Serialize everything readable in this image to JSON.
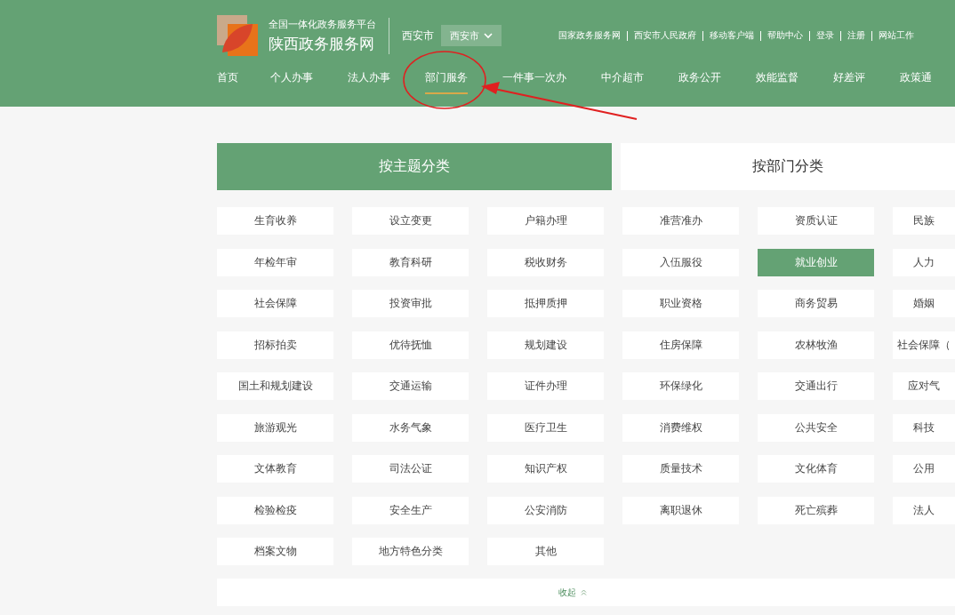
{
  "header": {
    "platform": "全国一体化政务服务平台",
    "site_name": "陕西政务服务网",
    "city": "西安市",
    "city_select": "西安市",
    "top_links": [
      "国家政务服务网",
      "西安市人民政府",
      "移动客户端",
      "帮助中心",
      "登录",
      "注册",
      "网站工作"
    ]
  },
  "nav": [
    {
      "label": "首页",
      "selected": false
    },
    {
      "label": "个人办事",
      "selected": false
    },
    {
      "label": "法人办事",
      "selected": false
    },
    {
      "label": "部门服务",
      "selected": true
    },
    {
      "label": "一件事一次办",
      "selected": false
    },
    {
      "label": "中介超市",
      "selected": false
    },
    {
      "label": "政务公开",
      "selected": false
    },
    {
      "label": "效能监督",
      "selected": false
    },
    {
      "label": "好差评",
      "selected": false
    },
    {
      "label": "政策通",
      "selected": false
    }
  ],
  "tabs": [
    {
      "label": "按主题分类",
      "selected": true
    },
    {
      "label": "按部门分类",
      "selected": false
    }
  ],
  "categories": [
    {
      "label": "生育收养",
      "selected": false
    },
    {
      "label": "设立变更",
      "selected": false
    },
    {
      "label": "户籍办理",
      "selected": false
    },
    {
      "label": "准营准办",
      "selected": false
    },
    {
      "label": "资质认证",
      "selected": false
    },
    {
      "label": "民族",
      "selected": false
    },
    {
      "label": "年检年审",
      "selected": false
    },
    {
      "label": "教育科研",
      "selected": false
    },
    {
      "label": "税收财务",
      "selected": false
    },
    {
      "label": "入伍服役",
      "selected": false
    },
    {
      "label": "就业创业",
      "selected": true
    },
    {
      "label": "人力",
      "selected": false
    },
    {
      "label": "社会保障",
      "selected": false
    },
    {
      "label": "投资审批",
      "selected": false
    },
    {
      "label": "抵押质押",
      "selected": false
    },
    {
      "label": "职业资格",
      "selected": false
    },
    {
      "label": "商务贸易",
      "selected": false
    },
    {
      "label": "婚姻",
      "selected": false
    },
    {
      "label": "招标拍卖",
      "selected": false
    },
    {
      "label": "优待抚恤",
      "selected": false
    },
    {
      "label": "规划建设",
      "selected": false
    },
    {
      "label": "住房保障",
      "selected": false
    },
    {
      "label": "农林牧渔",
      "selected": false
    },
    {
      "label": "社会保障（",
      "selected": false
    },
    {
      "label": "国土和规划建设",
      "selected": false
    },
    {
      "label": "交通运输",
      "selected": false
    },
    {
      "label": "证件办理",
      "selected": false
    },
    {
      "label": "环保绿化",
      "selected": false
    },
    {
      "label": "交通出行",
      "selected": false
    },
    {
      "label": "应对气",
      "selected": false
    },
    {
      "label": "旅游观光",
      "selected": false
    },
    {
      "label": "水务气象",
      "selected": false
    },
    {
      "label": "医疗卫生",
      "selected": false
    },
    {
      "label": "消费维权",
      "selected": false
    },
    {
      "label": "公共安全",
      "selected": false
    },
    {
      "label": "科技",
      "selected": false
    },
    {
      "label": "文体教育",
      "selected": false
    },
    {
      "label": "司法公证",
      "selected": false
    },
    {
      "label": "知识产权",
      "selected": false
    },
    {
      "label": "质量技术",
      "selected": false
    },
    {
      "label": "文化体育",
      "selected": false
    },
    {
      "label": "公用",
      "selected": false
    },
    {
      "label": "检验检疫",
      "selected": false
    },
    {
      "label": "安全生产",
      "selected": false
    },
    {
      "label": "公安消防",
      "selected": false
    },
    {
      "label": "离职退休",
      "selected": false
    },
    {
      "label": "死亡殡葬",
      "selected": false
    },
    {
      "label": "法人",
      "selected": false
    },
    {
      "label": "档案文物",
      "selected": false
    },
    {
      "label": "地方特色分类",
      "selected": false
    },
    {
      "label": "其他",
      "selected": false
    }
  ],
  "collapse": {
    "label": "收起"
  }
}
